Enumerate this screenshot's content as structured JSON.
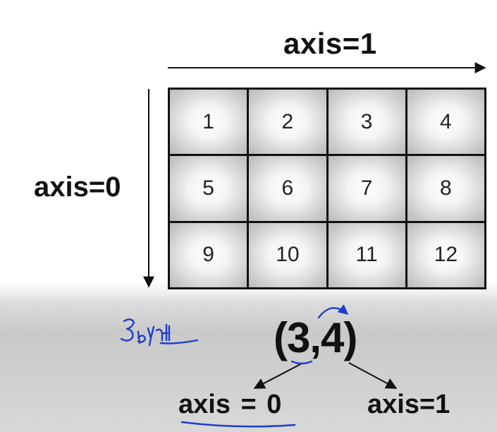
{
  "top_axis_label": "axis=1",
  "left_axis_label": "axis=0",
  "grid": {
    "rows": [
      [
        "1",
        "2",
        "3",
        "4"
      ],
      [
        "5",
        "6",
        "7",
        "8"
      ],
      [
        "9",
        "10",
        "11",
        "12"
      ]
    ]
  },
  "shape_label": "(3,4)",
  "bottom_left_label": "axis = 0",
  "bottom_right_label": "axis=1",
  "handwritten_note": "3 by 4",
  "colors": {
    "ink": "#111111",
    "annotation_blue": "#1d3fc9"
  }
}
